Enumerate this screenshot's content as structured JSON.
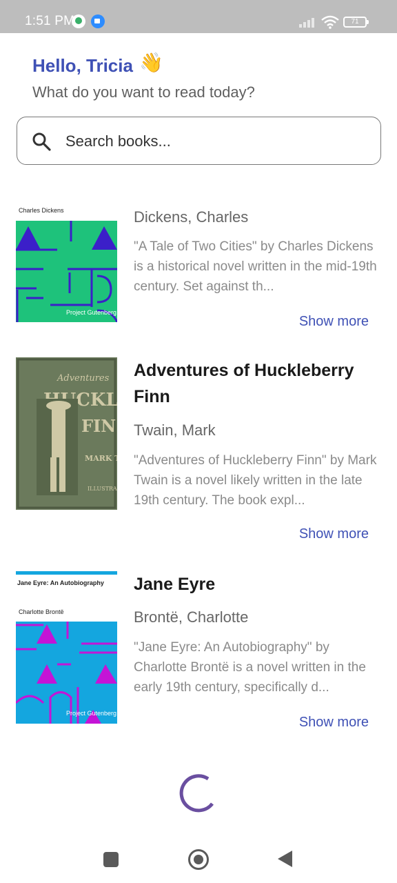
{
  "status_bar": {
    "time": "1:51 PM",
    "battery": "71",
    "icons": [
      "sync-icon",
      "meet-icon",
      "signal-icon",
      "wifi-icon",
      "battery-icon"
    ]
  },
  "header": {
    "greeting": "Hello, Tricia",
    "wave_emoji": "👋",
    "subtitle": "What do you want to read today?"
  },
  "search": {
    "placeholder": "Search books...",
    "value": ""
  },
  "books": [
    {
      "title": "",
      "author": "Dickens, Charles",
      "description": "\"A Tale of Two Cities\" by Charles Dickens is a historical novel written in the mid-19th century. Set against th...",
      "show_more": "Show more",
      "cover": {
        "top_label": "Charles Dickens",
        "bottom_label": "Project Gutenberg",
        "bg": "#1ec27b",
        "accent": "#3b1fc9"
      }
    },
    {
      "title": "Adventures of Huckleberry Finn",
      "author": "Twain, Mark",
      "description": "\"Adventures of Huckleberry Finn\" by Mark Twain is a novel likely written in the late 19th century. The book expl...",
      "show_more": "Show more",
      "cover": {
        "bg": "#6b7a5c",
        "accent": "#cfc9a6"
      }
    },
    {
      "title": "Jane Eyre",
      "author": "Brontë, Charlotte",
      "description": "\"Jane Eyre: An Autobiography\" by Charlotte Brontë is a novel written in the early 19th century, specifically d...",
      "show_more": "Show more",
      "cover": {
        "top_label": "Jane Eyre: An Autobiography",
        "mid_label": "Charlotte Brontë",
        "bottom_label": "Project Gutenberg",
        "bg": "#14a6df",
        "accent": "#c414d6"
      }
    }
  ],
  "colors": {
    "accent": "#3f51b5",
    "spinner": "#6a4fa0"
  },
  "nav_bar": [
    "recents-button",
    "home-button",
    "back-button"
  ]
}
